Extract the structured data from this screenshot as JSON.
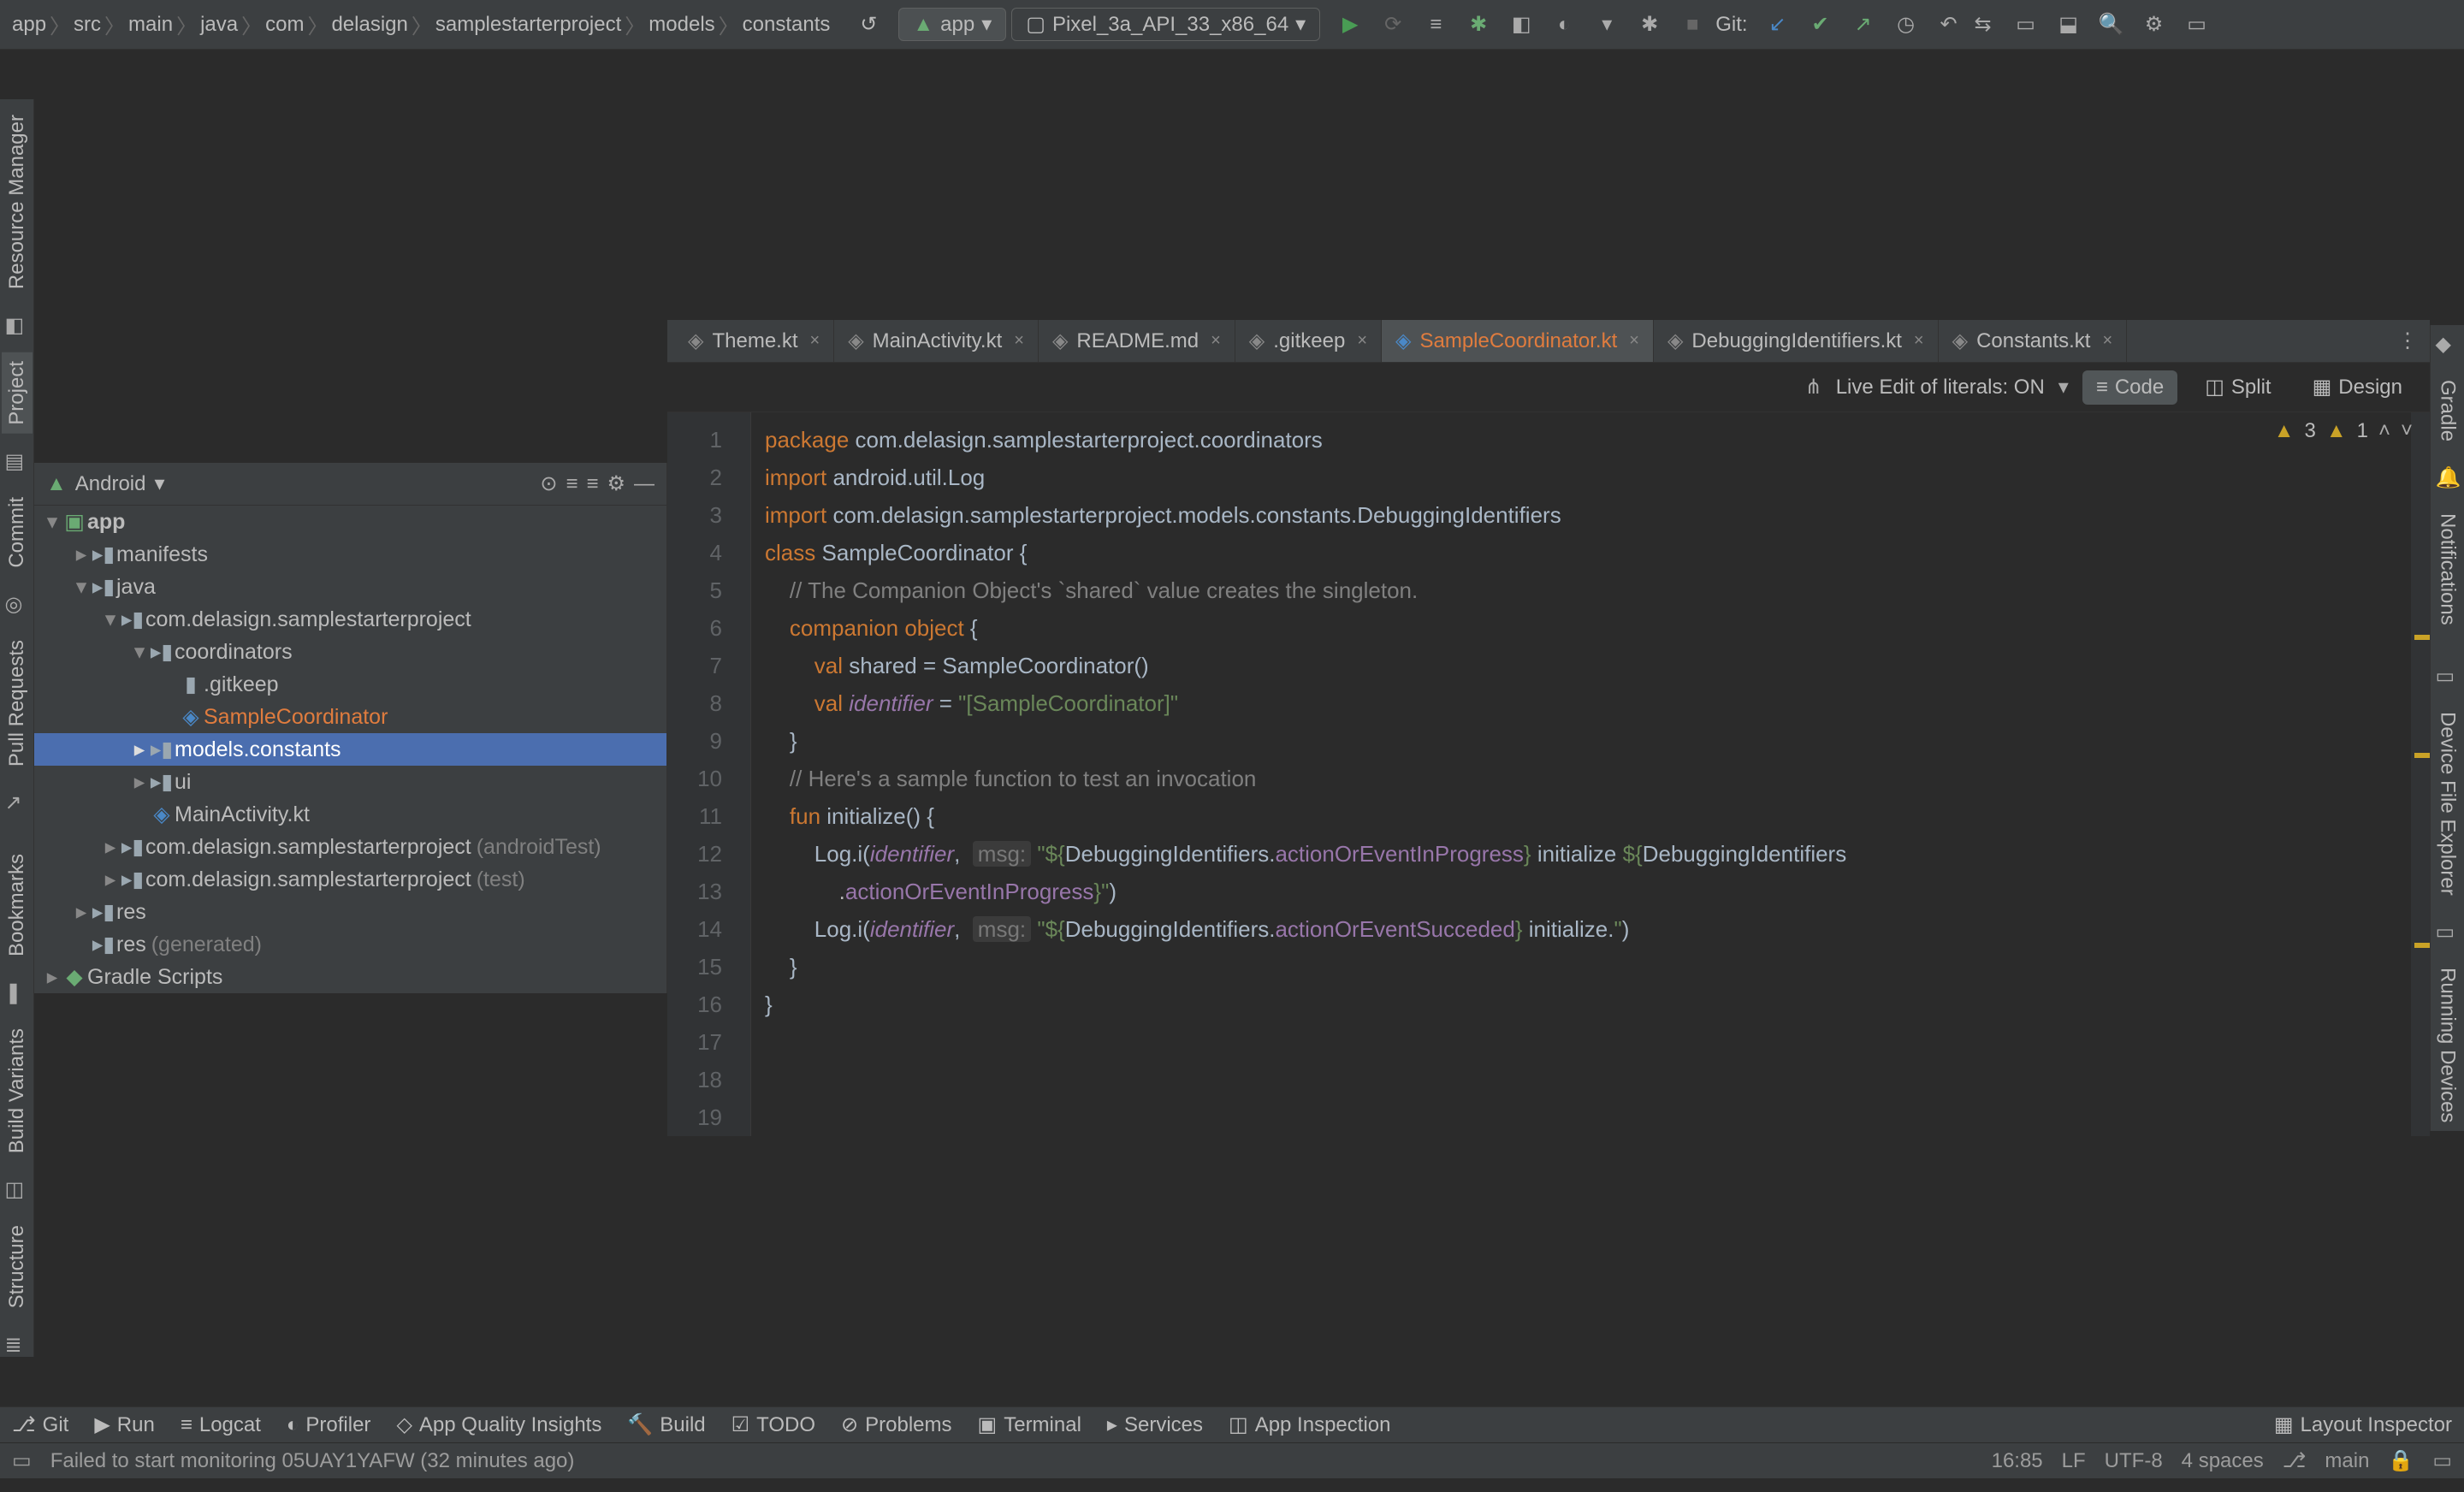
{
  "breadcrumb": [
    "app",
    "src",
    "main",
    "java",
    "com",
    "delasign",
    "samplestarterproject",
    "models",
    "constants"
  ],
  "run_config": "app",
  "device": "Pixel_3a_API_33_x86_64",
  "git_label": "Git:",
  "tabs": [
    {
      "label": "Theme.kt",
      "active": false
    },
    {
      "label": "MainActivity.kt",
      "active": false
    },
    {
      "label": "README.md",
      "active": false
    },
    {
      "label": ".gitkeep",
      "active": false
    },
    {
      "label": "SampleCoordinator.kt",
      "active": true,
      "orange": true
    },
    {
      "label": "DebuggingIdentifiers.kt",
      "active": false
    },
    {
      "label": "Constants.kt",
      "active": false
    }
  ],
  "left_tabs": [
    "Resource Manager",
    "Project",
    "Commit",
    "Pull Requests",
    "Bookmarks",
    "Build Variants",
    "Structure"
  ],
  "right_tabs": [
    "Gradle",
    "Notifications",
    "Device File Explorer",
    "Running Devices"
  ],
  "project_head": {
    "label": "Android"
  },
  "tree": [
    {
      "indent": 0,
      "arrow": "v",
      "icon": "module",
      "label": "app",
      "bold": true
    },
    {
      "indent": 1,
      "arrow": ">",
      "icon": "folder",
      "label": "manifests"
    },
    {
      "indent": 1,
      "arrow": "v",
      "icon": "folder",
      "label": "java"
    },
    {
      "indent": 2,
      "arrow": "v",
      "icon": "folder",
      "label": "com.delasign.samplestarterproject"
    },
    {
      "indent": 3,
      "arrow": "v",
      "icon": "folder",
      "label": "coordinators"
    },
    {
      "indent": 4,
      "arrow": "",
      "icon": "file",
      "label": ".gitkeep"
    },
    {
      "indent": 4,
      "arrow": "",
      "icon": "kt",
      "label": "SampleCoordinator",
      "orange": true
    },
    {
      "indent": 3,
      "arrow": ">",
      "icon": "folder",
      "label": "models.constants",
      "sel": true
    },
    {
      "indent": 3,
      "arrow": ">",
      "icon": "folder",
      "label": "ui"
    },
    {
      "indent": 3,
      "arrow": "",
      "icon": "kt",
      "label": "MainActivity.kt"
    },
    {
      "indent": 2,
      "arrow": ">",
      "icon": "folder",
      "label": "com.delasign.samplestarterproject",
      "secondary": "(androidTest)"
    },
    {
      "indent": 2,
      "arrow": ">",
      "icon": "folder",
      "label": "com.delasign.samplestarterproject",
      "secondary": "(test)"
    },
    {
      "indent": 1,
      "arrow": ">",
      "icon": "folder",
      "label": "res"
    },
    {
      "indent": 1,
      "arrow": "",
      "icon": "folder",
      "label": "res",
      "secondary": "(generated)"
    },
    {
      "indent": 0,
      "arrow": ">",
      "icon": "gradle",
      "label": "Gradle Scripts"
    }
  ],
  "editor_modes": {
    "live": "Live Edit of literals: ON",
    "code": "Code",
    "split": "Split",
    "design": "Design"
  },
  "warnings": {
    "w": "3",
    "i": "1"
  },
  "code_lines": [
    {
      "n": 1,
      "t": "package",
      "r": " com.delasign.samplestarterproject.coordinators"
    },
    {
      "n": 2,
      "t": "",
      "r": ""
    },
    {
      "n": 3,
      "t": "import",
      "r": " android.util.Log"
    },
    {
      "n": 4,
      "t": "import",
      "r": " com.delasign.samplestarterproject.models.constants.DebuggingIdentifiers"
    },
    {
      "n": 5,
      "t": "",
      "r": ""
    },
    {
      "n": 6,
      "t": "class",
      "r": " SampleCoordinator {"
    },
    {
      "n": 7,
      "c": "    // The Companion Object's `shared` value creates the singleton."
    },
    {
      "n": 8,
      "kw": "    companion object",
      "r": " {"
    },
    {
      "n": 9,
      "kw": "        val",
      "r": " shared = SampleCoordinator()"
    },
    {
      "n": 10,
      "kw": "        val",
      "it": " identifier",
      "r": " = ",
      "s": "\"[SampleCoordinator]\""
    },
    {
      "n": 11,
      "r": "    }"
    },
    {
      "n": 12,
      "r": ""
    },
    {
      "n": 13,
      "c": "    // Here's a sample function to test an invocation"
    },
    {
      "n": 14,
      "kw": "    fun",
      "r": " initialize() {"
    },
    {
      "n": 15,
      "log": "        Log.i(",
      "idv": "identifier",
      "comma": ",  ",
      "hint": "msg:",
      "s1": " \"${",
      "p1": "DebuggingIdentifiers.",
      "m1": "actionOrEventInProgress",
      "s2": "} ",
      "txt": "initialize ",
      "s3": "${",
      "p2": "DebuggingIdentifiers",
      "br": "\n            .",
      "m2": "actionOrEventInProgress",
      "s4": "}\"",
      ")": ")"
    },
    {
      "n": 16,
      "log": "        Log.i(",
      "idv": "identifier",
      "comma": ",  ",
      "hint": "msg:",
      "s1": " \"${",
      "p1": "DebuggingIdentifiers.",
      "m1": "actionOrEventSucceded",
      "s2": "} ",
      "txt": "initialize.",
      "s4": "\"",
      ")": ")"
    },
    {
      "n": 17,
      "r": "    }"
    },
    {
      "n": 18,
      "r": "}"
    },
    {
      "n": 19,
      "r": ""
    }
  ],
  "bottom": [
    {
      "icon": "git",
      "label": "Git"
    },
    {
      "icon": "play",
      "label": "Run"
    },
    {
      "icon": "logcat",
      "label": "Logcat"
    },
    {
      "icon": "profiler",
      "label": "Profiler"
    },
    {
      "icon": "quality",
      "label": "App Quality Insights"
    },
    {
      "icon": "hammer",
      "label": "Build"
    },
    {
      "icon": "todo",
      "label": "TODO"
    },
    {
      "icon": "problems",
      "label": "Problems"
    },
    {
      "icon": "terminal",
      "label": "Terminal"
    },
    {
      "icon": "services",
      "label": "Services"
    },
    {
      "icon": "inspect",
      "label": "App Inspection"
    }
  ],
  "layout_inspector": "Layout Inspector",
  "status": {
    "msg": "Failed to start monitoring 05UAY1YAFW (32 minutes ago)",
    "pos": "16:85",
    "le": "LF",
    "enc": "UTF-8",
    "indent": "4 spaces",
    "branch": "main"
  }
}
